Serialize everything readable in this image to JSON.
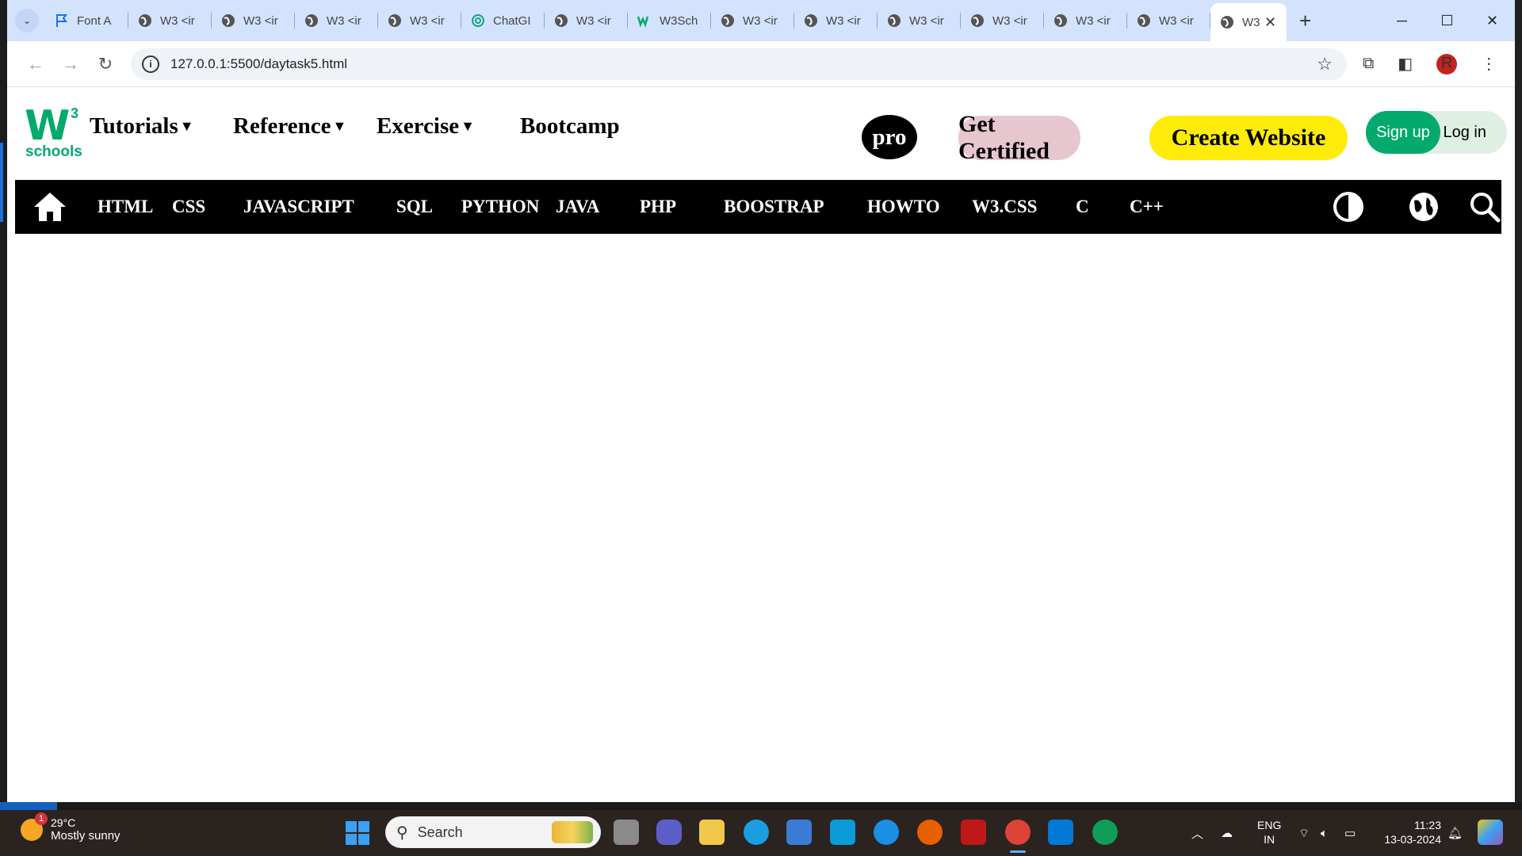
{
  "browser": {
    "tabs": [
      {
        "label": "Font A",
        "icon": "flag-icon"
      },
      {
        "label": "W3 <ir",
        "icon": "globe-icon"
      },
      {
        "label": "W3 <ir",
        "icon": "globe-icon"
      },
      {
        "label": "W3 <ir",
        "icon": "globe-icon"
      },
      {
        "label": "W3 <ir",
        "icon": "globe-icon"
      },
      {
        "label": "ChatGI",
        "icon": "chatgpt-icon"
      },
      {
        "label": "W3 <ir",
        "icon": "globe-icon"
      },
      {
        "label": "W3Sch",
        "icon": "w3schools-icon"
      },
      {
        "label": "W3 <ir",
        "icon": "globe-icon"
      },
      {
        "label": "W3 <ir",
        "icon": "globe-icon"
      },
      {
        "label": "W3 <ir",
        "icon": "globe-icon"
      },
      {
        "label": "W3 <ir",
        "icon": "globe-icon"
      },
      {
        "label": "W3 <ir",
        "icon": "globe-icon"
      },
      {
        "label": "W3 <ir",
        "icon": "globe-icon"
      }
    ],
    "active_tab": {
      "label": "W3",
      "close": "✕"
    },
    "new_tab": "+",
    "url": "127.0.0.1:5500/daytask5.html",
    "profile_initial": "R"
  },
  "site": {
    "logo_w": "W",
    "logo_sup": "3",
    "logo_text": "schools",
    "menu": [
      {
        "label": "Tutorials",
        "caret": "▼"
      },
      {
        "label": "Reference",
        "caret": "▼"
      },
      {
        "label": "Exercise",
        "caret": "▼"
      },
      {
        "label": "Bootcamp",
        "caret": ""
      }
    ],
    "pro": "pro",
    "get_certified": "Get Certified",
    "create_website": "Create Website",
    "sign_up": "Sign up",
    "log_in": "Log in",
    "subnav": [
      "HTML",
      "CSS",
      "JAVASCRIPT",
      "SQL",
      "PYTHON",
      "JAVA",
      "PHP",
      "BOOSTRAP",
      "HOWTO",
      "W3.CSS",
      "C",
      "C++"
    ],
    "colors": {
      "brand_green": "#04aa6d",
      "yellow": "#ffeb0a",
      "pink": "#e7c7cf"
    }
  },
  "taskbar": {
    "weather_badge": "1",
    "temperature": "29°C",
    "condition": "Mostly sunny",
    "search_placeholder": "Search",
    "lang_1": "ENG",
    "lang_2": "IN",
    "time": "11:23",
    "date": "13-03-2024"
  }
}
